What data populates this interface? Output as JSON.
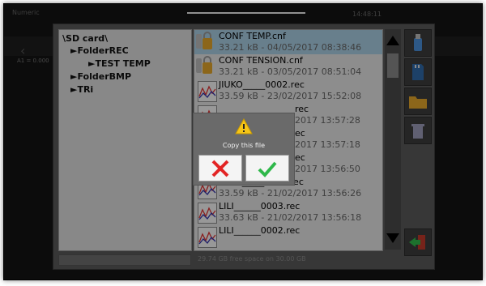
{
  "background": {
    "title": "Numeric",
    "time": "14:48:11",
    "left_label": "A1 = 0.000"
  },
  "tree": {
    "root": "\\SD card\\",
    "items": [
      {
        "label": "►FolderREC",
        "level": 1
      },
      {
        "label": "►TEST TEMP",
        "level": 2
      },
      {
        "label": "►FolderBMP",
        "level": 1
      },
      {
        "label": "►TRi",
        "level": 1
      }
    ]
  },
  "files": [
    {
      "name": "CONF TEMP.cnf",
      "info": "33.21 kB - 04/05/2017 08:38:46",
      "icon": "config-file-icon",
      "selected": true
    },
    {
      "name": "CONF TENSION.cnf",
      "info": "33.21 kB - 03/05/2017 08:51:04",
      "icon": "config-file-icon",
      "selected": false
    },
    {
      "name": "JIUKO_____0002.rec",
      "info": "33.59 kB - 23/02/2017 15:52:08",
      "icon": "recording-file-icon",
      "selected": false
    },
    {
      "name": "rec",
      "info": "2017 13:57:28",
      "icon": "recording-file-icon",
      "selected": false
    },
    {
      "name": "ec",
      "info": "2017 13:57:18",
      "icon": "recording-file-icon",
      "selected": false
    },
    {
      "name": "ec",
      "info": "2017 13:56:50",
      "icon": "recording-file-icon",
      "selected": false
    },
    {
      "name": "LOLO_____0001.rec",
      "info": "33.59 kB - 21/02/2017 13:56:26",
      "icon": "recording-file-icon",
      "selected": false
    },
    {
      "name": "LILI______0003.rec",
      "info": "33.63 kB - 21/02/2017 13:56:18",
      "icon": "recording-file-icon",
      "selected": false
    },
    {
      "name": "LILI______0002.rec",
      "info": "",
      "icon": "recording-file-icon",
      "selected": false
    }
  ],
  "free_space": "29.74 GB free space on 30.00 GB",
  "confirm": {
    "message": "Copy this file",
    "cancel_icon": "cross-icon",
    "ok_icon": "checkmark-icon"
  },
  "tools": [
    "usb-icon",
    "sd-card-icon",
    "folder-icon",
    "trash-icon",
    "exit-icon"
  ],
  "colors": {
    "selected_row": "#a9cde2",
    "cancel": "#e32424",
    "ok": "#2fb84a",
    "warning": "#f5c518"
  }
}
